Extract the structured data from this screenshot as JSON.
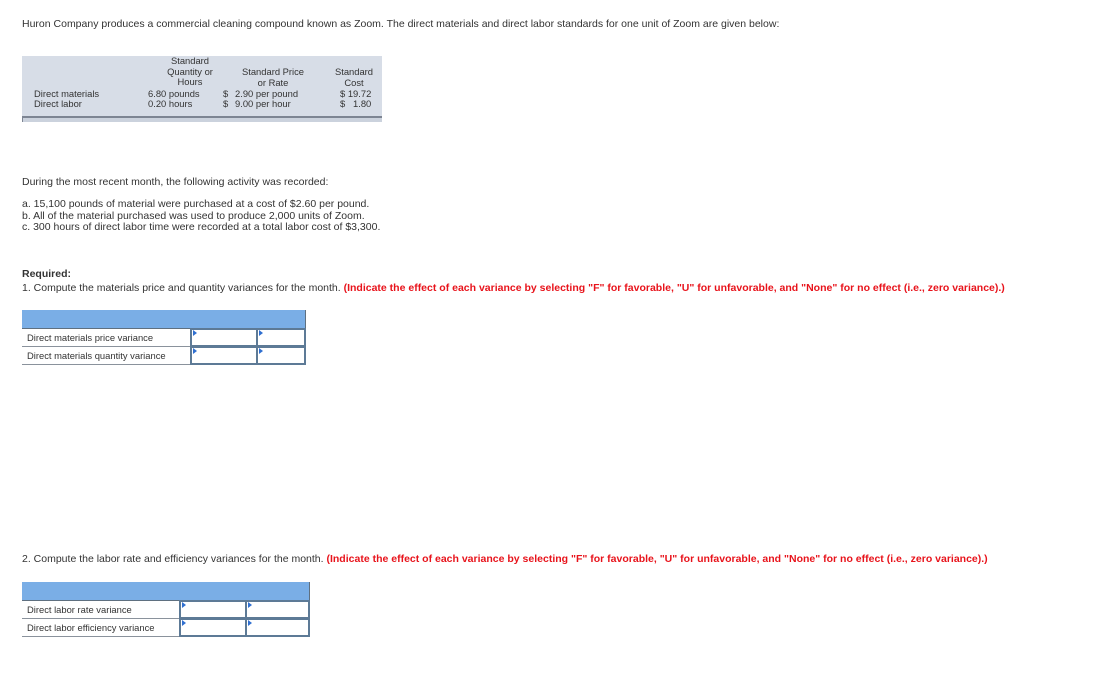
{
  "intro": "Huron Company produces a commercial cleaning compound known as Zoom. The direct materials and direct labor standards for one unit of Zoom are given below:",
  "standards_table": {
    "headers": {
      "quantity": [
        "Standard",
        "Quantity or",
        "Hours"
      ],
      "price": [
        "Standard Price",
        "or Rate"
      ],
      "cost": [
        "Standard",
        "Cost"
      ]
    },
    "rows": [
      {
        "label": "Direct materials",
        "quantity": "6.80 pounds",
        "price_symbol": "$",
        "price": "2.90 per pound",
        "cost": "$ 19.72"
      },
      {
        "label": "Direct labor",
        "quantity": "0.20 hours",
        "price_symbol": "$",
        "price": "9.00 per hour",
        "cost": "$   1.80"
      }
    ]
  },
  "activity_intro": "During the most recent month, the following activity was recorded:",
  "activity": [
    "a. 15,100 pounds of material were purchased at a cost of $2.60 per pound.",
    "b. All of the material purchased was used to produce 2,000 units of Zoom.",
    "c. 300 hours of direct labor time were recorded at a total labor cost of $3,300."
  ],
  "required_label": "Required:",
  "question1": {
    "text": "1. Compute the materials price and quantity variances for the month.",
    "hint": "(Indicate the effect of each variance by selecting \"F\" for favorable, \"U\" for unfavorable, and \"None\" for no effect (i.e., zero variance).)",
    "rows": [
      {
        "label": "Direct materials price variance",
        "amount": "",
        "effect": ""
      },
      {
        "label": "Direct materials quantity variance",
        "amount": "",
        "effect": ""
      }
    ]
  },
  "question2": {
    "text": "2. Compute the labor rate and efficiency variances for the month.",
    "hint": "(Indicate the effect of each variance by selecting \"F\" for favorable, \"U\" for unfavorable, and \"None\" for no effect (i.e., zero variance).)",
    "rows": [
      {
        "label": "Direct labor rate variance",
        "amount": "",
        "effect": ""
      },
      {
        "label": "Direct labor efficiency variance",
        "amount": "",
        "effect": ""
      }
    ]
  },
  "colors": {
    "grid_header": "#7aaee6",
    "table_bg": "#d7dde7",
    "hint_red": "#e8131b",
    "input_border": "#5d7a96"
  }
}
